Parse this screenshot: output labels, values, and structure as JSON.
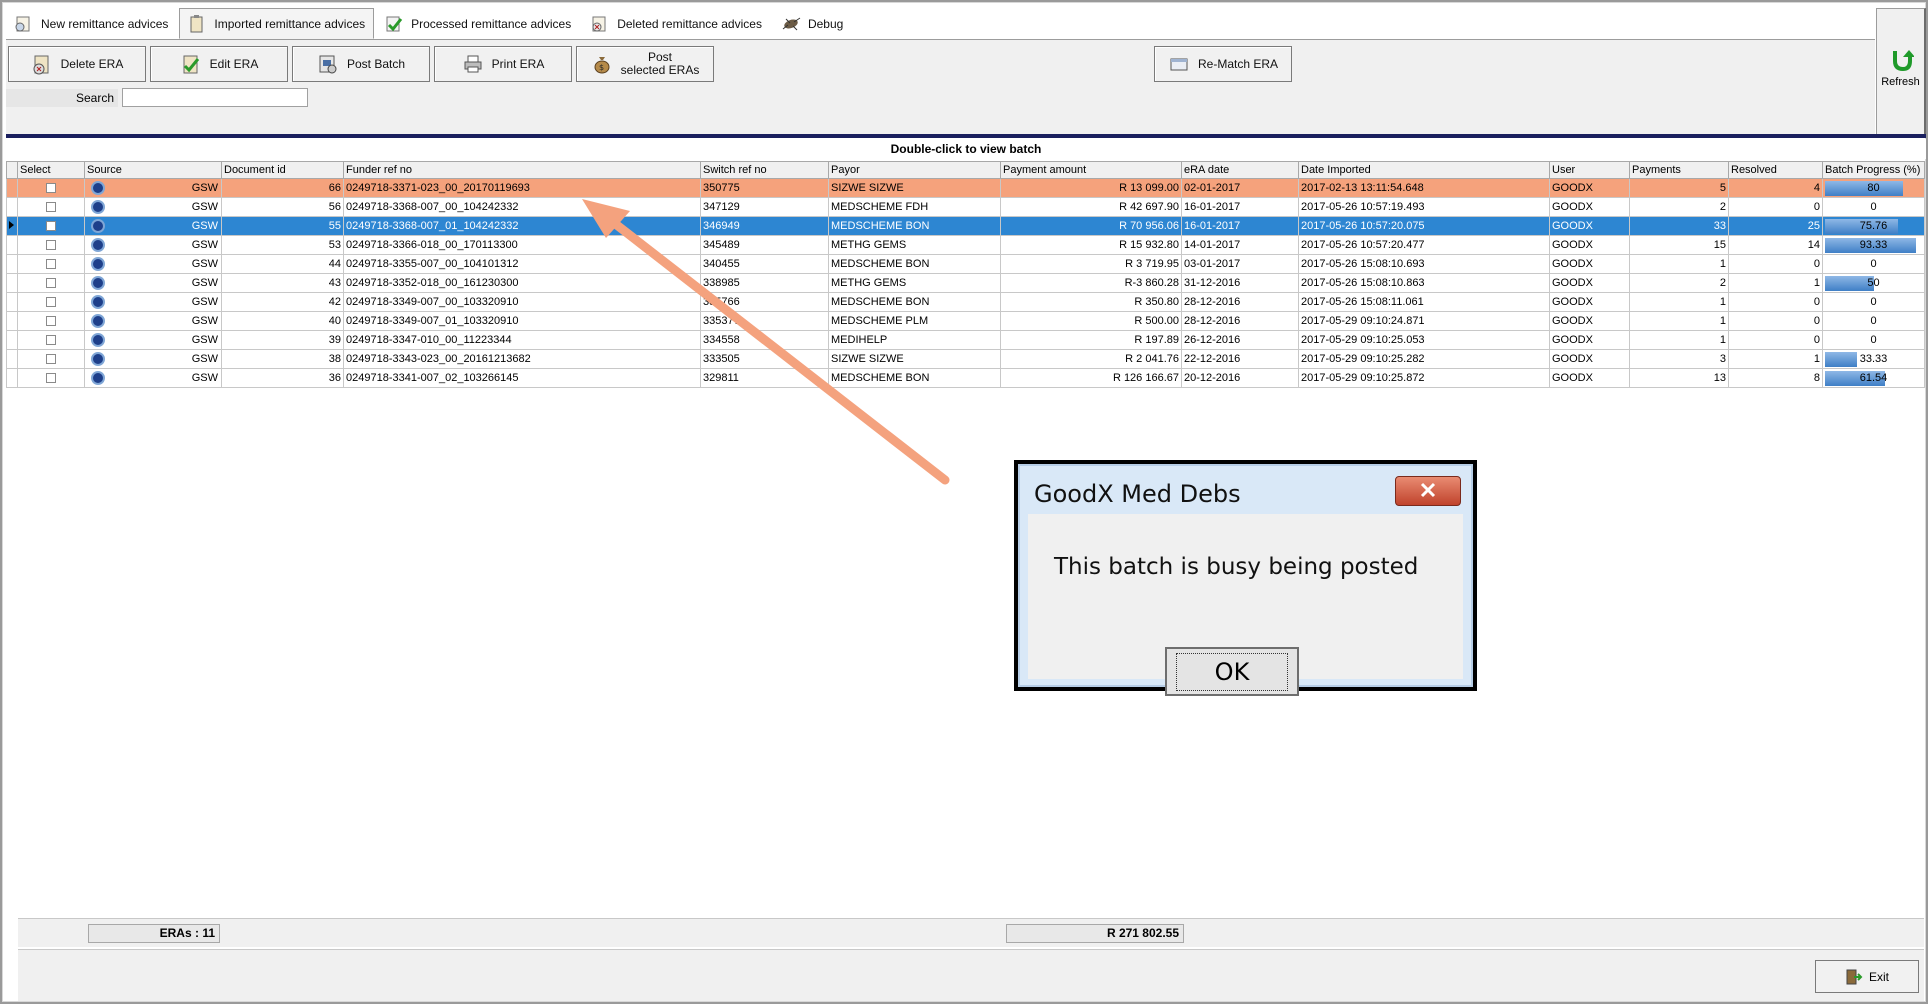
{
  "tabs": [
    {
      "label": "New remittance advices"
    },
    {
      "label": "Imported remittance advices"
    },
    {
      "label": "Processed remittance advices"
    },
    {
      "label": "Deleted remittance advices"
    },
    {
      "label": "Debug"
    }
  ],
  "toolbar": {
    "delete_label": "Delete ERA",
    "edit_label": "Edit ERA",
    "post_batch_label": "Post Batch",
    "print_label": "Print ERA",
    "post_selected_line1": "Post",
    "post_selected_line2": "selected ERAs",
    "rematch_label": "Re-Match ERA",
    "refresh_label": "Refresh"
  },
  "search": {
    "label": "Search",
    "value": ""
  },
  "grid": {
    "caption": "Double-click to view batch",
    "columns": [
      "Select",
      "Source",
      "Document id",
      "Funder ref no",
      "Switch ref no",
      "Payor",
      "Payment amount",
      "eRA date",
      "Date Imported",
      "User",
      "Payments",
      "Resolved",
      "Batch Progress (%)"
    ],
    "rows": [
      {
        "source": "GSW",
        "doc_id": "66",
        "funder_ref": "0249718-3371-023_00_20170119693",
        "switch_ref": "350775",
        "payor": "SIZWE SIZWE",
        "amount": "R 13 099.00",
        "era_date": "02-01-2017",
        "imported": "2017-02-13 13:11:54.648",
        "user": "GOODX",
        "payments": "5",
        "resolved": "4",
        "progress": 80,
        "progress_label": "80",
        "state": "orange"
      },
      {
        "source": "GSW",
        "doc_id": "56",
        "funder_ref": "0249718-3368-007_00_104242332",
        "switch_ref": "347129",
        "payor": "MEDSCHEME FDH",
        "amount": "R 42 697.90",
        "era_date": "16-01-2017",
        "imported": "2017-05-26 10:57:19.493",
        "user": "GOODX",
        "payments": "2",
        "resolved": "0",
        "progress": 0,
        "progress_label": "0",
        "state": ""
      },
      {
        "source": "GSW",
        "doc_id": "55",
        "funder_ref": "0249718-3368-007_01_104242332",
        "switch_ref": "346949",
        "payor": "MEDSCHEME BON",
        "amount": "R 70 956.06",
        "era_date": "16-01-2017",
        "imported": "2017-05-26 10:57:20.075",
        "user": "GOODX",
        "payments": "33",
        "resolved": "25",
        "progress": 75.76,
        "progress_label": "75.76",
        "state": "blue"
      },
      {
        "source": "GSW",
        "doc_id": "53",
        "funder_ref": "0249718-3366-018_00_170113300",
        "switch_ref": "345489",
        "payor": "METHG GEMS",
        "amount": "R 15 932.80",
        "era_date": "14-01-2017",
        "imported": "2017-05-26 10:57:20.477",
        "user": "GOODX",
        "payments": "15",
        "resolved": "14",
        "progress": 93.33,
        "progress_label": "93.33",
        "state": ""
      },
      {
        "source": "GSW",
        "doc_id": "44",
        "funder_ref": "0249718-3355-007_00_104101312",
        "switch_ref": "340455",
        "payor": "MEDSCHEME BON",
        "amount": "R 3 719.95",
        "era_date": "03-01-2017",
        "imported": "2017-05-26 15:08:10.693",
        "user": "GOODX",
        "payments": "1",
        "resolved": "0",
        "progress": 0,
        "progress_label": "0",
        "state": ""
      },
      {
        "source": "GSW",
        "doc_id": "43",
        "funder_ref": "0249718-3352-018_00_161230300",
        "switch_ref": "338985",
        "payor": "METHG GEMS",
        "amount": "R-3 860.28",
        "era_date": "31-12-2016",
        "imported": "2017-05-26 15:08:10.863",
        "user": "GOODX",
        "payments": "2",
        "resolved": "1",
        "progress": 50,
        "progress_label": "50",
        "state": ""
      },
      {
        "source": "GSW",
        "doc_id": "42",
        "funder_ref": "0249718-3349-007_00_103320910",
        "switch_ref": "335766",
        "payor": "MEDSCHEME BON",
        "amount": "R 350.80",
        "era_date": "28-12-2016",
        "imported": "2017-05-26 15:08:11.061",
        "user": "GOODX",
        "payments": "1",
        "resolved": "0",
        "progress": 0,
        "progress_label": "0",
        "state": ""
      },
      {
        "source": "GSW",
        "doc_id": "40",
        "funder_ref": "0249718-3349-007_01_103320910",
        "switch_ref": "335377",
        "payor": "MEDSCHEME PLM",
        "amount": "R 500.00",
        "era_date": "28-12-2016",
        "imported": "2017-05-29 09:10:24.871",
        "user": "GOODX",
        "payments": "1",
        "resolved": "0",
        "progress": 0,
        "progress_label": "0",
        "state": ""
      },
      {
        "source": "GSW",
        "doc_id": "39",
        "funder_ref": "0249718-3347-010_00_11223344",
        "switch_ref": "334558",
        "payor": "MEDIHELP",
        "amount": "R 197.89",
        "era_date": "26-12-2016",
        "imported": "2017-05-29 09:10:25.053",
        "user": "GOODX",
        "payments": "1",
        "resolved": "0",
        "progress": 0,
        "progress_label": "0",
        "state": ""
      },
      {
        "source": "GSW",
        "doc_id": "38",
        "funder_ref": "0249718-3343-023_00_20161213682",
        "switch_ref": "333505",
        "payor": "SIZWE SIZWE",
        "amount": "R 2 041.76",
        "era_date": "22-12-2016",
        "imported": "2017-05-29 09:10:25.282",
        "user": "GOODX",
        "payments": "3",
        "resolved": "1",
        "progress": 33.33,
        "progress_label": "33.33",
        "state": ""
      },
      {
        "source": "GSW",
        "doc_id": "36",
        "funder_ref": "0249718-3341-007_02_103266145",
        "switch_ref": "329811",
        "payor": "MEDSCHEME BON",
        "amount": "R 126 166.67",
        "era_date": "20-12-2016",
        "imported": "2017-05-29 09:10:25.872",
        "user": "GOODX",
        "payments": "13",
        "resolved": "8",
        "progress": 61.54,
        "progress_label": "61.54",
        "state": ""
      }
    ]
  },
  "footer": {
    "era_count": "ERAs : 11",
    "total": "R 271 802.55",
    "exit_label": "Exit"
  },
  "dialog": {
    "title": "GoodX Med Debs",
    "message": "This batch is busy being posted",
    "ok_label": "OK"
  },
  "colors": {
    "selected_row": "#2d86d2",
    "busy_row": "#f5a27c",
    "arrow": "#f4a27e",
    "progress": "#3f7fc6"
  }
}
